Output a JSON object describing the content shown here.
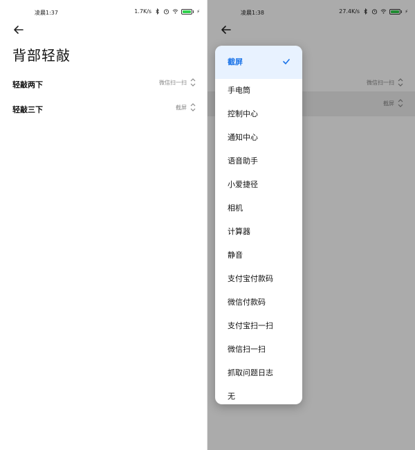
{
  "left": {
    "status_time": "凌晨1:37",
    "status_speed": "1.7K/s",
    "title": "背部轻敲",
    "rows": [
      {
        "label": "轻敲两下",
        "value": "微信扫一扫"
      },
      {
        "label": "轻敲三下",
        "value": "截屏"
      }
    ]
  },
  "right": {
    "status_time": "凌晨1:38",
    "status_speed": "27.4K/s",
    "rows": [
      {
        "value": "微信扫一扫"
      },
      {
        "value": "截屏"
      }
    ],
    "menu": {
      "items": [
        "截屏",
        "手电筒",
        "控制中心",
        "通知中心",
        "语音助手",
        "小爱捷径",
        "相机",
        "计算器",
        "静音",
        "支付宝付款码",
        "微信付款码",
        "支付宝扫一扫",
        "微信扫一扫",
        "抓取问题日志",
        "无"
      ],
      "selected_index": 0
    }
  },
  "colors": {
    "accent": "#1a73e8",
    "battery": "#2fcf4b"
  },
  "icons": [
    "back-arrow-icon",
    "updown-chevron-icon",
    "check-icon",
    "bluetooth-icon",
    "alarm-icon",
    "wifi-icon",
    "battery-icon",
    "bolt-icon"
  ]
}
